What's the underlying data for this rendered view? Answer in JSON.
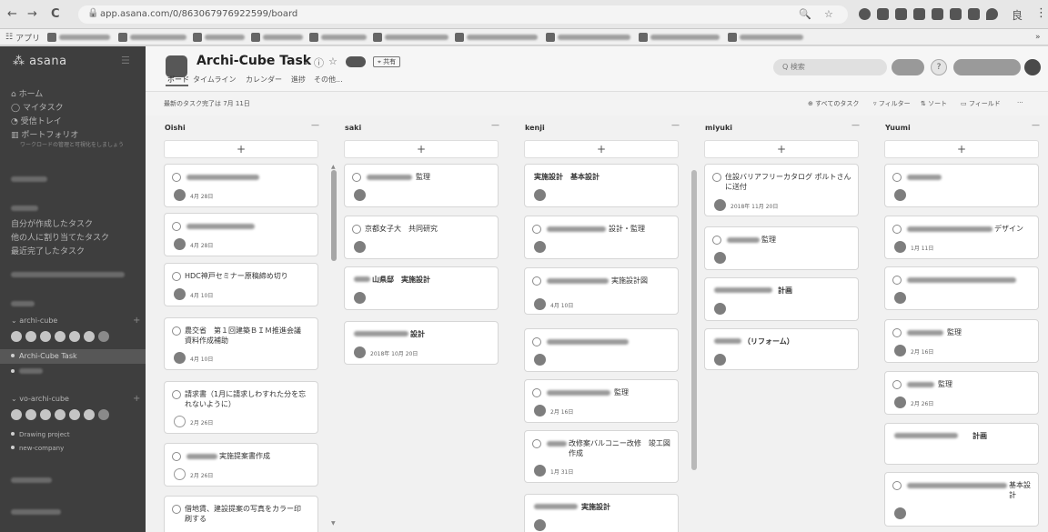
{
  "chrome": {
    "nav_back": "←",
    "nav_forward": "→",
    "reload": "C",
    "lock": "🔒",
    "url": "app.asana.com/0/863067976922599/board",
    "zoom_icon": "🔍",
    "star_icon": "☆",
    "user_initial": "良",
    "menu": "⋮"
  },
  "bookmarks": {
    "apps": "アプリ",
    "items": [
      "",
      "",
      "",
      "",
      "",
      "",
      "",
      "",
      "",
      ""
    ],
    "more": "»"
  },
  "sidebar": {
    "logo": "asana",
    "collapse": "☰",
    "home": "ホーム",
    "my_tasks": "マイタスク",
    "inbox": "受信トレイ",
    "portfolio": "ポートフォリオ",
    "portfolio_sub": "ワークロードの管理と可視化をしましょう",
    "reports": [
      "自分が作成したタスク",
      "他の人に割り当てたタスク",
      "最近完了したタスク"
    ],
    "team1": "archi-cube",
    "team1_projects": [
      {
        "label": "Archi-Cube Task",
        "active": true
      },
      {
        "label": "",
        "active": false
      }
    ],
    "team2": "vo-archi-cube",
    "team2_projects": [
      "Drawing project",
      "new-company"
    ],
    "team_plus": "+"
  },
  "project": {
    "title": "Archi-Cube Task",
    "dropdown": "⌄",
    "status_icon": "ⓘ",
    "favorite_icon": "☆",
    "public_label": "⌖ 共有",
    "tabs": [
      "ボード",
      "タイムライン",
      "カレンダー",
      "進捗",
      "その他..."
    ],
    "active_tab": 0,
    "search_placeholder": "Q 検索",
    "help": "?"
  },
  "subbar": {
    "left": "最新のタスク完了は 7月 11日",
    "actions": [
      "⊕ すべてのタスク",
      "▿ フィルター",
      "⇅ ソート",
      "▭ フィールド",
      "···"
    ]
  },
  "board": {
    "add_symbol": "+",
    "columns": [
      {
        "name": "Oishi",
        "more": "—",
        "cards": [
          {
            "text": "",
            "date": "4月 28日"
          },
          {
            "text": "",
            "date": "4月 28日"
          },
          {
            "text": "HDC神戸セミナー原稿締め切り",
            "date": "4月 10日"
          },
          {
            "text": "農交省　第１回建築ＢＩＭ推進会議資料作成補助",
            "date": "4月 10日"
          },
          {
            "text": "請求書（1月に請求しわすれた分を忘れないように）",
            "date": "2月 26日"
          },
          {
            "text": "実施提案書作成",
            "date": "2月 26日"
          },
          {
            "text": "借地賃、建設提案の写真をカラー印刷する",
            "date": ""
          }
        ]
      },
      {
        "name": "saki",
        "more": "—",
        "cards": [
          {
            "text": "監理",
            "date": ""
          },
          {
            "text": "京都女子大　共同研究",
            "date": ""
          },
          {
            "text": "山県邸　実施設計",
            "date": ""
          },
          {
            "text": "設計",
            "date": "2018年 10月 20日"
          }
        ]
      },
      {
        "name": "kenji",
        "more": "—",
        "cards": [
          {
            "text": "実施設計　基本設計",
            "date": ""
          },
          {
            "text": "設計・監理",
            "date": ""
          },
          {
            "text": "実施設計図",
            "date": "4月 10日"
          },
          {
            "text": "",
            "date": ""
          },
          {
            "text": "監理",
            "date": "2月 16日"
          },
          {
            "text": "改修案バルコニー改修　竣工図作成",
            "date": "1月 31日"
          },
          {
            "text": "実施設計",
            "date": ""
          }
        ]
      },
      {
        "name": "miyuki",
        "more": "—",
        "cards": [
          {
            "text": "住設バリアフリーカタログ ポルトさんに送付",
            "date": "2018年 11月 20日"
          },
          {
            "text": "監理",
            "date": ""
          },
          {
            "text": "計画",
            "date": ""
          },
          {
            "text": "（リフォーム）",
            "date": ""
          }
        ]
      },
      {
        "name": "Yuumi",
        "more": "—",
        "cards": [
          {
            "text": "",
            "date": ""
          },
          {
            "text": "デザイン",
            "date": "1月 11日"
          },
          {
            "text": "",
            "date": ""
          },
          {
            "text": "監理",
            "date": "2月 16日"
          },
          {
            "text": "監理",
            "date": "2月 26日"
          },
          {
            "text": "計画",
            "date": ""
          },
          {
            "text": "基本設計",
            "date": ""
          }
        ]
      }
    ]
  }
}
